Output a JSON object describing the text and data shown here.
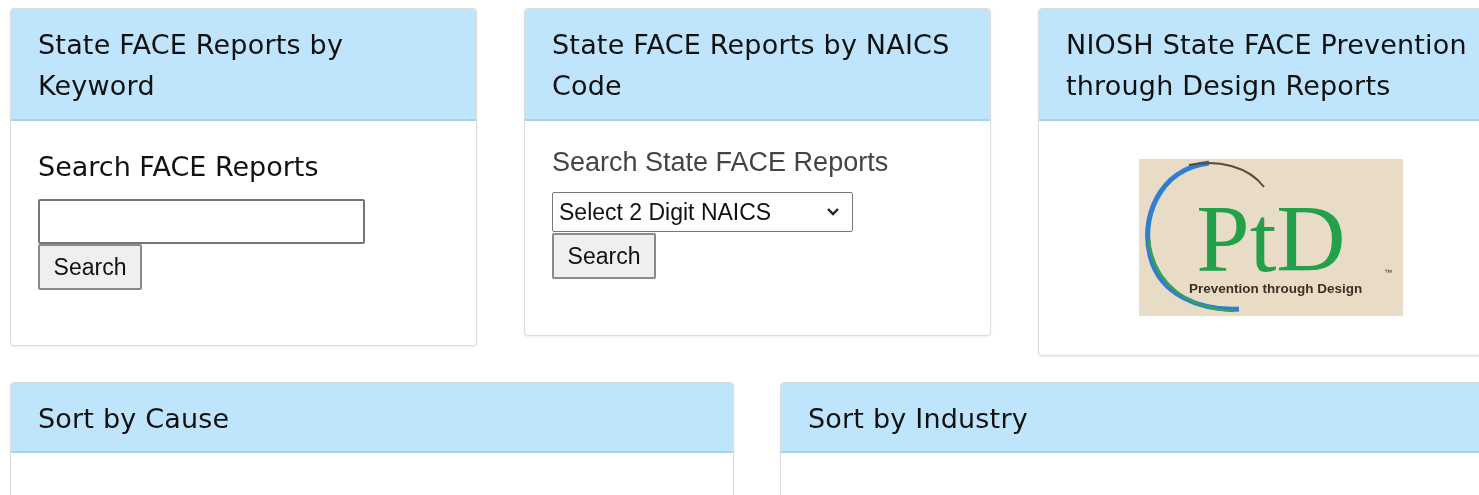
{
  "top_cards": [
    {
      "kind": "keyword",
      "title": "State FACE Reports by Keyword",
      "subtitle": "Search FACE Reports",
      "button": "Search"
    },
    {
      "kind": "naics",
      "title": "State FACE Reports by NAICS Code",
      "label": "Search State FACE Reports",
      "select": {
        "value": "Select 2 Digit NAICS"
      },
      "button": "Search"
    },
    {
      "kind": "logo",
      "title": "NIOSH State FACE Prevention through Design Reports",
      "logo": {
        "mark": "PtD",
        "tagline": "Prevention through Design",
        "trademark": "™"
      }
    }
  ],
  "bottom_cards": [
    {
      "title": "Sort by Cause"
    },
    {
      "title": "Sort by Industry"
    }
  ]
}
